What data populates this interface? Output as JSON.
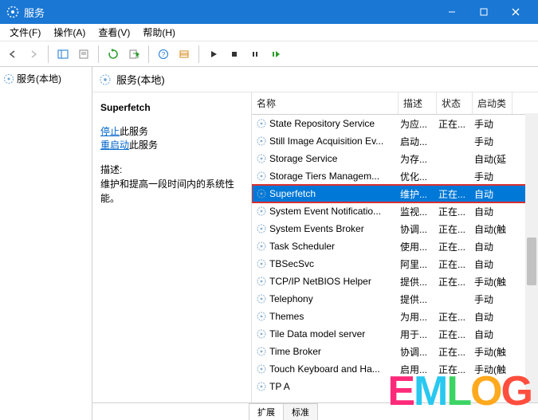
{
  "title": "服务",
  "menu": {
    "file": "文件(F)",
    "action": "操作(A)",
    "view": "查看(V)",
    "help": "帮助(H)"
  },
  "tree": {
    "root": "服务(本地)"
  },
  "panel_title": "服务(本地)",
  "detail": {
    "service_name": "Superfetch",
    "stop": "停止",
    "stop_suffix": "此服务",
    "restart": "重启动",
    "restart_suffix": "此服务",
    "desc_label": "描述:",
    "desc_text": "维护和提高一段时间内的系统性能。"
  },
  "columns": {
    "name": "名称",
    "desc": "描述",
    "status": "状态",
    "start": "启动类"
  },
  "rows": [
    {
      "name": "State Repository Service",
      "desc": "为应...",
      "status": "正在...",
      "start": "手动"
    },
    {
      "name": "Still Image Acquisition Ev...",
      "desc": "启动...",
      "status": "",
      "start": "手动"
    },
    {
      "name": "Storage Service",
      "desc": "为存...",
      "status": "",
      "start": "自动(延"
    },
    {
      "name": "Storage Tiers Managem...",
      "desc": "优化...",
      "status": "",
      "start": "手动"
    },
    {
      "name": "Superfetch",
      "desc": "维护...",
      "status": "正在...",
      "start": "自动",
      "selected": true
    },
    {
      "name": "System Event Notificatio...",
      "desc": "监视...",
      "status": "正在...",
      "start": "自动"
    },
    {
      "name": "System Events Broker",
      "desc": "协调...",
      "status": "正在...",
      "start": "自动(触"
    },
    {
      "name": "Task Scheduler",
      "desc": "使用...",
      "status": "正在...",
      "start": "自动"
    },
    {
      "name": "TBSecSvc",
      "desc": "阿里...",
      "status": "正在...",
      "start": "自动"
    },
    {
      "name": "TCP/IP NetBIOS Helper",
      "desc": "提供...",
      "status": "正在...",
      "start": "手动(触"
    },
    {
      "name": "Telephony",
      "desc": "提供...",
      "status": "",
      "start": "手动"
    },
    {
      "name": "Themes",
      "desc": "为用...",
      "status": "正在...",
      "start": "自动"
    },
    {
      "name": "Tile Data model server",
      "desc": "用于...",
      "status": "正在...",
      "start": "自动"
    },
    {
      "name": "Time Broker",
      "desc": "协调...",
      "status": "正在...",
      "start": "手动(触"
    },
    {
      "name": "Touch Keyboard and Ha...",
      "desc": "启用...",
      "status": "正在...",
      "start": "手动(触"
    },
    {
      "name": "TP A",
      "desc": "",
      "status": "",
      "start": ""
    }
  ],
  "tabs": {
    "ext": "扩展",
    "std": "标准"
  },
  "watermark": "EMLOG"
}
